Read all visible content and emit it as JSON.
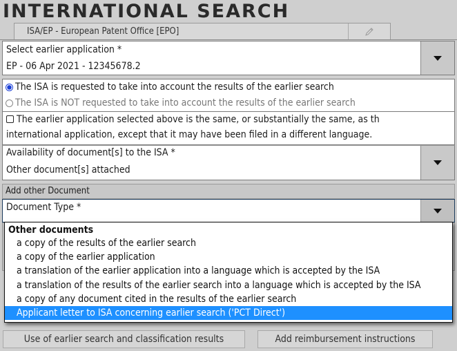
{
  "page": {
    "title": "INTERNATIONAL SEARCH",
    "isa_authority": "ISA/EP - European Patent Office [EPO]",
    "edit_icon": "pencil-icon"
  },
  "earlier_application": {
    "label": "Select earlier application *",
    "value": "EP - 06 Apr 2021 - 12345678.2"
  },
  "isa_request": {
    "options": [
      {
        "label": "The ISA is requested to take into account the results of the earlier search",
        "selected": true
      },
      {
        "label": "The ISA is NOT requested to take into account the results of the earlier search",
        "selected": false
      }
    ]
  },
  "same_application": {
    "checked": false,
    "line1": "The earlier application selected above is the same, or substantially the same, as th",
    "line2": "international application, except that it may have been filed in a different language."
  },
  "availability": {
    "label": "Availability of document[s] to the ISA *",
    "value": "Other document[s] attached"
  },
  "add_document": {
    "section_label": "Add other Document",
    "doc_type_label": "Document Type *",
    "dropdown": {
      "group": "Other documents",
      "items": [
        "a copy of the results of the earlier search",
        "a copy of the earlier application",
        "a translation of the earlier application into a language which is accepted by the ISA",
        "a translation of the results of the earlier search into a language which is accepted by the ISA",
        "a copy of any document cited in the results of the earlier search",
        "Applicant letter to ISA concerning earlier search ('PCT Direct')"
      ],
      "highlighted_index": 5
    }
  },
  "buttons": {
    "use_earlier": "Use of earlier search and classification results",
    "reimbursement": "Add reimbursement instructions"
  },
  "colors": {
    "highlight": "#1e90ff",
    "radio_selected": "#1a3fd6"
  }
}
